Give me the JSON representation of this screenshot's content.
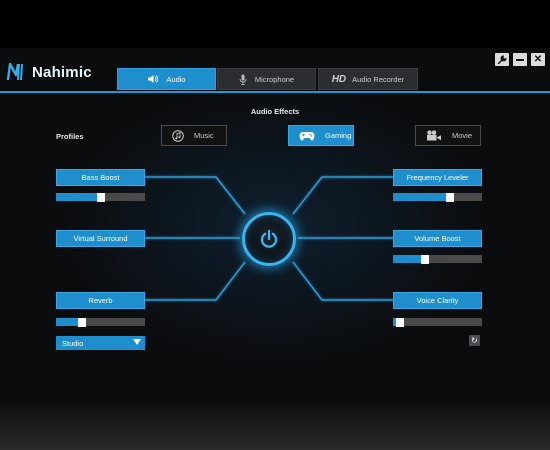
{
  "app": {
    "logo_text": "Nahimic"
  },
  "tabs": [
    {
      "label": "Audio",
      "icon": "speaker-icon",
      "active": true
    },
    {
      "label": "Microphone",
      "icon": "microphone-icon",
      "active": false
    },
    {
      "label": "Audio Recorder",
      "prefix": "HD",
      "active": false
    }
  ],
  "window_controls": {
    "settings": "wrench-icon",
    "minimize": "minimize-icon",
    "close": "close-icon"
  },
  "section_title": "Audio Effects",
  "profiles": {
    "label": "Profiles",
    "items": [
      {
        "label": "Music",
        "icon": "music-note-icon",
        "active": false
      },
      {
        "label": "Gaming",
        "icon": "gamepad-icon",
        "active": true
      },
      {
        "label": "Movie",
        "icon": "camera-icon",
        "active": false
      }
    ]
  },
  "effects_left": [
    {
      "label": "Bass Boost",
      "level": 0.5,
      "has_slider": true
    },
    {
      "label": "Virtual Surround",
      "has_slider": false
    },
    {
      "label": "Reverb",
      "level": 0.27,
      "has_slider": true
    }
  ],
  "effects_right": [
    {
      "label": "Frequency Leveler",
      "level": 0.66,
      "has_slider": true
    },
    {
      "label": "Volume Boost",
      "level": 0.35,
      "has_slider": true
    },
    {
      "label": "Voice Clarity",
      "level": 0.04,
      "has_slider": true
    }
  ],
  "reverb_preset": {
    "selected": "Studio"
  },
  "colors": {
    "accent": "#1e8fcc",
    "glow": "#38b6f2",
    "background": "#0b0c0e"
  }
}
